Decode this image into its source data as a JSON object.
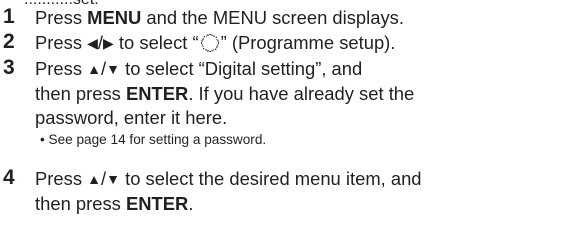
{
  "cut_text": "...........set.",
  "steps": [
    {
      "number": "1",
      "parts": {
        "a": "Press ",
        "b": "MENU",
        "c": " and the MENU screen displays."
      }
    },
    {
      "number": "2",
      "parts": {
        "a": "Press ",
        "left_arrow": "◀",
        "slash": "/",
        "right_arrow": "▶",
        "b": " to select “",
        "icon": "programme-setup-icon",
        "c": "” (Programme setup)."
      }
    },
    {
      "number": "3",
      "parts": {
        "a": "Press ",
        "up_arrow": "▲",
        "slash": "/",
        "down_arrow": "▼",
        "b": " to select “Digital setting”, and",
        "c": "then press ",
        "d": "ENTER",
        "e": ". If you have already set the",
        "f": "password, enter it here."
      },
      "note": "• See page 14 for setting a password."
    },
    {
      "number": "4",
      "parts": {
        "a": "Press ",
        "up_arrow": "▲",
        "slash": "/",
        "down_arrow": "▼",
        "b": " to select the desired menu item, and",
        "c": "then press ",
        "d": "ENTER",
        "e": "."
      }
    }
  ]
}
